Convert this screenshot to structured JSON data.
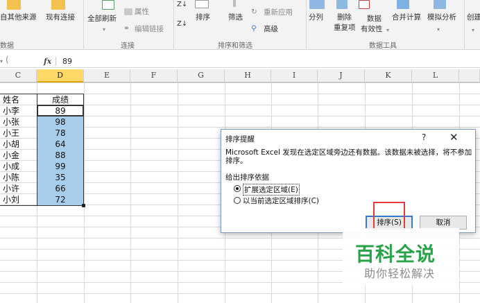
{
  "ribbon": {
    "get_external_data": "自其他来源",
    "existing_connections": "现有连接",
    "refresh_all": "全部刷新",
    "properties": "属性",
    "edit_links": "编辑链接",
    "sort": "排序",
    "filter": "筛选",
    "reapply": "重新应用",
    "advanced": "高级",
    "text_to_columns": "分列",
    "remove_duplicates_l1": "删除",
    "remove_duplicates_l2": "重复项",
    "data_validation_l1": "数据",
    "data_validation_l2": "有效性",
    "consolidate": "合并计算",
    "what_if": "模拟分析",
    "create": "创建",
    "group_data": "数据",
    "group_connections": "连接",
    "group_sort_filter": "排序和筛选",
    "group_data_tools": "数据工具"
  },
  "formula_bar": {
    "fx": "fx",
    "value": "89"
  },
  "columns": [
    "C",
    "D",
    "E",
    "F",
    "G",
    "H",
    "I",
    "J",
    "K",
    "L"
  ],
  "table": {
    "header_name": "姓名",
    "header_score": "成绩",
    "rows": [
      {
        "name": "小李",
        "score": "89"
      },
      {
        "name": "小张",
        "score": "98"
      },
      {
        "name": "小王",
        "score": "78"
      },
      {
        "name": "小胡",
        "score": "64"
      },
      {
        "name": "小金",
        "score": "88"
      },
      {
        "name": "小成",
        "score": "99"
      },
      {
        "name": "小陈",
        "score": "35"
      },
      {
        "name": "小许",
        "score": "66"
      },
      {
        "name": "小刘",
        "score": "72"
      }
    ]
  },
  "dialog": {
    "title": "排序提醒",
    "help": "?",
    "close": "✕",
    "message": "Microsoft Excel 发现在选定区域旁边还有数据。该数据未被选择，将不参加排序。",
    "section": "给出排序依据",
    "option_expand": "扩展选定区域(E)",
    "option_current": "以当前选定区域排序(C)",
    "sort_button": "排序(S)",
    "cancel_button": "取消"
  },
  "watermark": {
    "title": "百科全说",
    "subtitle": "助你轻松解决"
  },
  "colors": {
    "selected_col_header": "#ffd867",
    "cell_highlight": "#a6cdec",
    "annotation_red": "#e23b3b",
    "watermark_green": "#2aa24a"
  }
}
